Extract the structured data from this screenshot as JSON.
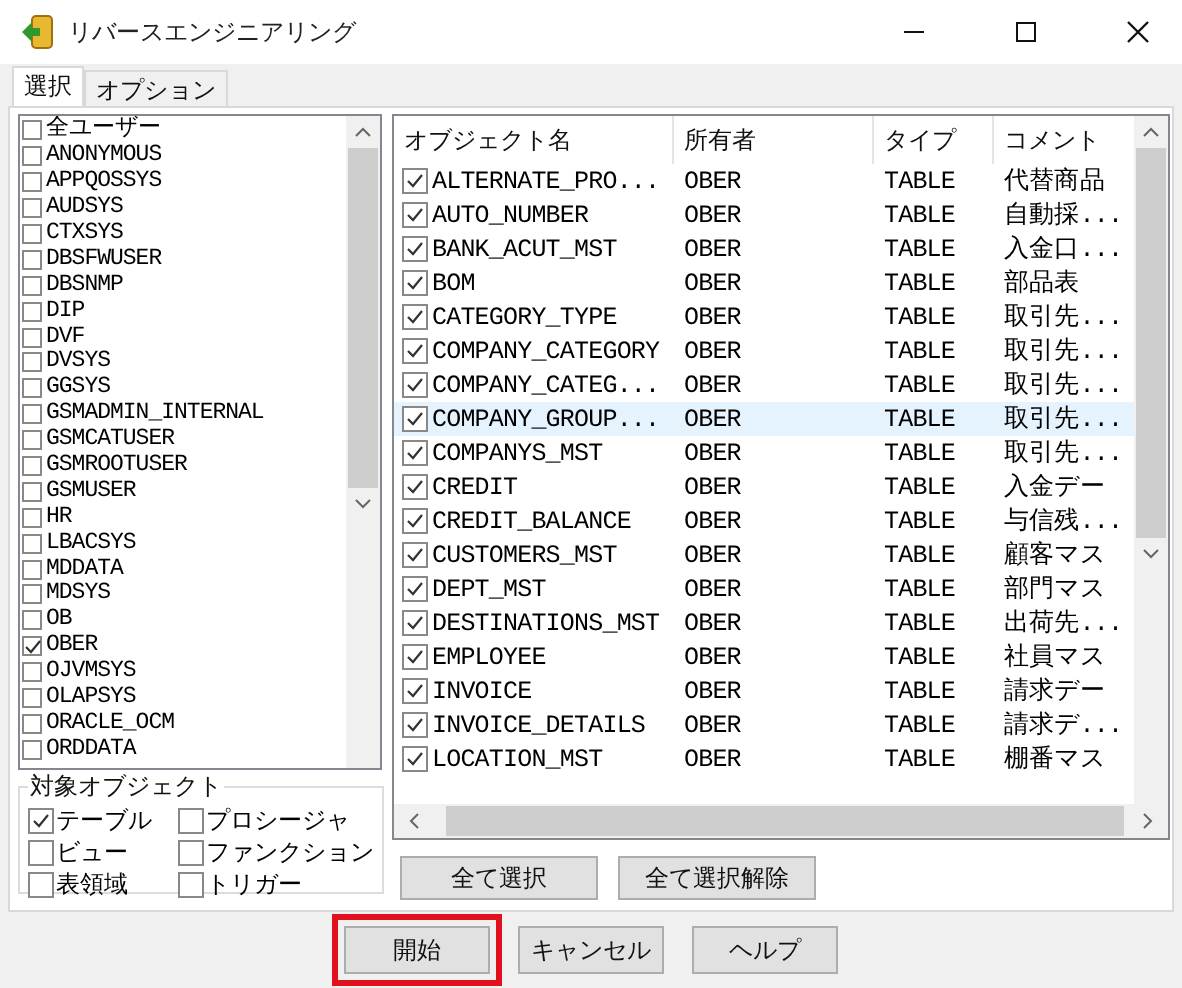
{
  "window": {
    "title": "リバースエンジニアリング"
  },
  "tabs": [
    {
      "label": "選択",
      "selected": true
    },
    {
      "label": "オプション",
      "selected": false
    }
  ],
  "users": [
    {
      "name": "全ユーザー",
      "checked": false
    },
    {
      "name": "ANONYMOUS",
      "checked": false
    },
    {
      "name": "APPQOSSYS",
      "checked": false
    },
    {
      "name": "AUDSYS",
      "checked": false
    },
    {
      "name": "CTXSYS",
      "checked": false
    },
    {
      "name": "DBSFWUSER",
      "checked": false
    },
    {
      "name": "DBSNMP",
      "checked": false
    },
    {
      "name": "DIP",
      "checked": false
    },
    {
      "name": "DVF",
      "checked": false
    },
    {
      "name": "DVSYS",
      "checked": false
    },
    {
      "name": "GGSYS",
      "checked": false
    },
    {
      "name": "GSMADMIN_INTERNAL",
      "checked": false
    },
    {
      "name": "GSMCATUSER",
      "checked": false
    },
    {
      "name": "GSMROOTUSER",
      "checked": false
    },
    {
      "name": "GSMUSER",
      "checked": false
    },
    {
      "name": "HR",
      "checked": false
    },
    {
      "name": "LBACSYS",
      "checked": false
    },
    {
      "name": "MDDATA",
      "checked": false
    },
    {
      "name": "MDSYS",
      "checked": false
    },
    {
      "name": "OB",
      "checked": false
    },
    {
      "name": "OBER",
      "checked": true
    },
    {
      "name": "OJVMSYS",
      "checked": false
    },
    {
      "name": "OLAPSYS",
      "checked": false
    },
    {
      "name": "ORACLE_OCM",
      "checked": false
    },
    {
      "name": "ORDDATA",
      "checked": false
    }
  ],
  "object_types": {
    "title": "対象オブジェクト",
    "items": [
      {
        "label": "テーブル",
        "checked": true
      },
      {
        "label": "プロシージャ",
        "checked": false
      },
      {
        "label": "ビュー",
        "checked": false
      },
      {
        "label": "ファンクション",
        "checked": false
      },
      {
        "label": "表領域",
        "checked": false
      },
      {
        "label": "トリガー",
        "checked": false
      }
    ]
  },
  "table": {
    "columns": [
      "オブジェクト名",
      "所有者",
      "タイプ",
      "コメント"
    ],
    "rows": [
      {
        "cells": [
          "ALTERNATE_PRO...",
          "OBER",
          "TABLE",
          "代替商品"
        ],
        "checked": true,
        "selected": false
      },
      {
        "cells": [
          "AUTO_NUMBER",
          "OBER",
          "TABLE",
          "自動採..."
        ],
        "checked": true,
        "selected": false
      },
      {
        "cells": [
          "BANK_ACUT_MST",
          "OBER",
          "TABLE",
          "入金口..."
        ],
        "checked": true,
        "selected": false
      },
      {
        "cells": [
          "BOM",
          "OBER",
          "TABLE",
          "部品表"
        ],
        "checked": true,
        "selected": false
      },
      {
        "cells": [
          "CATEGORY_TYPE",
          "OBER",
          "TABLE",
          "取引先..."
        ],
        "checked": true,
        "selected": false
      },
      {
        "cells": [
          "COMPANY_CATEGORY",
          "OBER",
          "TABLE",
          "取引先..."
        ],
        "checked": true,
        "selected": false
      },
      {
        "cells": [
          "COMPANY_CATEG...",
          "OBER",
          "TABLE",
          "取引先..."
        ],
        "checked": true,
        "selected": false
      },
      {
        "cells": [
          "COMPANY_GROUP...",
          "OBER",
          "TABLE",
          "取引先..."
        ],
        "checked": true,
        "selected": true
      },
      {
        "cells": [
          "COMPANYS_MST",
          "OBER",
          "TABLE",
          "取引先..."
        ],
        "checked": true,
        "selected": false
      },
      {
        "cells": [
          "CREDIT",
          "OBER",
          "TABLE",
          "入金デー"
        ],
        "checked": true,
        "selected": false
      },
      {
        "cells": [
          "CREDIT_BALANCE",
          "OBER",
          "TABLE",
          "与信残..."
        ],
        "checked": true,
        "selected": false
      },
      {
        "cells": [
          "CUSTOMERS_MST",
          "OBER",
          "TABLE",
          "顧客マス"
        ],
        "checked": true,
        "selected": false
      },
      {
        "cells": [
          "DEPT_MST",
          "OBER",
          "TABLE",
          "部門マス"
        ],
        "checked": true,
        "selected": false
      },
      {
        "cells": [
          "DESTINATIONS_MST",
          "OBER",
          "TABLE",
          "出荷先..."
        ],
        "checked": true,
        "selected": false
      },
      {
        "cells": [
          "EMPLOYEE",
          "OBER",
          "TABLE",
          "社員マス"
        ],
        "checked": true,
        "selected": false
      },
      {
        "cells": [
          "INVOICE",
          "OBER",
          "TABLE",
          "請求デー"
        ],
        "checked": true,
        "selected": false
      },
      {
        "cells": [
          "INVOICE_DETAILS",
          "OBER",
          "TABLE",
          "請求デ..."
        ],
        "checked": true,
        "selected": false
      },
      {
        "cells": [
          "LOCATION_MST",
          "OBER",
          "TABLE",
          "棚番マス"
        ],
        "checked": true,
        "selected": false
      }
    ]
  },
  "table_buttons": [
    "全て選択",
    "全て選択解除"
  ],
  "buttons": [
    {
      "label": "開始",
      "highlighted": true
    },
    {
      "label": "キャンセル",
      "highlighted": false
    },
    {
      "label": "ヘルプ",
      "highlighted": false
    }
  ]
}
